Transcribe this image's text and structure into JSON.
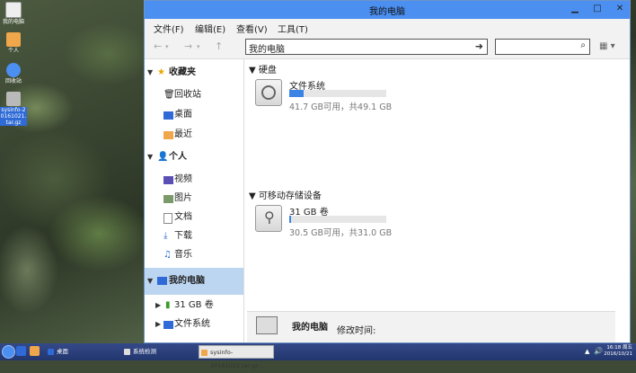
{
  "desktop": {
    "icons": [
      {
        "label": "我的电脑",
        "icon": "computer-icon"
      },
      {
        "label": "个人",
        "icon": "home-folder-icon"
      },
      {
        "label": "回收站",
        "icon": "trash-icon"
      },
      {
        "label": "sysinfo-20161021.tar.gz",
        "icon": "archive-icon"
      }
    ]
  },
  "window": {
    "title": "我的电脑",
    "menu": [
      "文件(F)",
      "编辑(E)",
      "查看(V)",
      "工具(T)"
    ],
    "address": "我的电脑",
    "search_placeholder": "",
    "accent": "#4b8ff0"
  },
  "sidebar": {
    "favorites_label": "收藏夹",
    "favorites": [
      "回收站",
      "桌面",
      "最近"
    ],
    "personal_label": "个人",
    "personal": [
      "视频",
      "图片",
      "文档",
      "下载",
      "音乐"
    ],
    "computer_label": "我的电脑",
    "computer": [
      "31 GB 卷",
      "文件系统"
    ]
  },
  "main": {
    "hard_disk_header": "硬盘",
    "removable_header": "可移动存储设备",
    "drives": [
      {
        "name": "文件系统",
        "info": "41.7 GB可用，共49.1 GB",
        "used_fraction": 0.15
      },
      {
        "name": "31 GB 卷",
        "info": "30.5 GB可用，共31.0 GB",
        "used_fraction": 0.02
      }
    ],
    "details": {
      "name": "我的电脑",
      "modified_label": "修改时间:"
    }
  },
  "taskbar": {
    "items": [
      "桌面",
      "系统检测",
      "sysinfo-20161021.tar.gz..."
    ],
    "time": "16:18 周五",
    "date": "2016/10/21"
  }
}
